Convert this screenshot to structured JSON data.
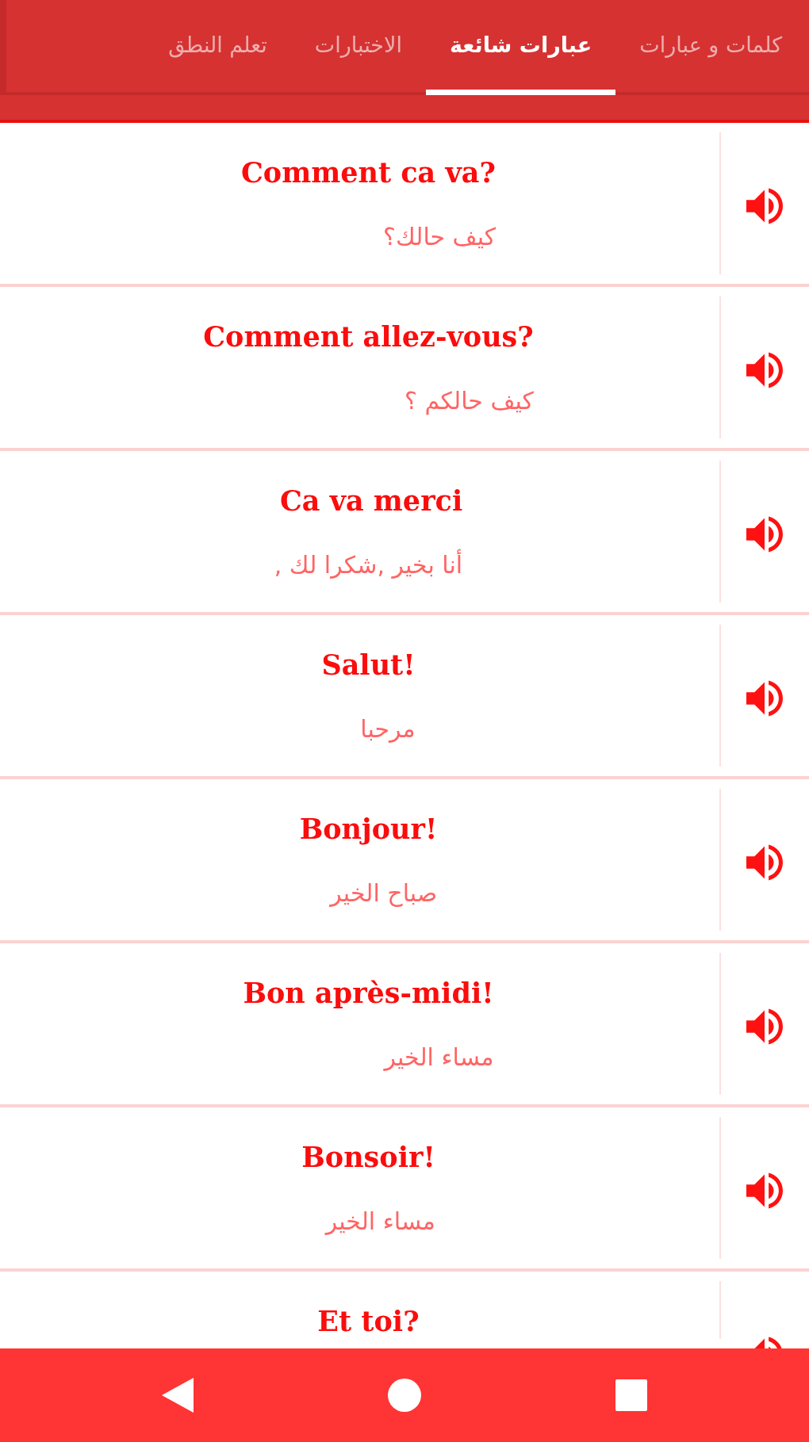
{
  "tabs": [
    {
      "label": "كلمات و عبارات",
      "selected": false
    },
    {
      "label": "عبارات شائعة",
      "selected": true
    },
    {
      "label": "الاختبارات",
      "selected": false
    },
    {
      "label": "تعلم النطق",
      "selected": false
    }
  ],
  "phrases": [
    {
      "french": "Comment ca va?",
      "arabic": "كيف حالك؟"
    },
    {
      "french": "Comment allez-vous?",
      "arabic": "كيف حالكم ؟"
    },
    {
      "french": "Ca va merci",
      "arabic": "أنا بخير ,شكرا لك ,"
    },
    {
      "french": "Salut!",
      "arabic": "مرحبا"
    },
    {
      "french": "Bonjour!",
      "arabic": "صباح الخير"
    },
    {
      "french": "Bon après-midi!",
      "arabic": "مساء الخير"
    },
    {
      "french": "Bonsoir!",
      "arabic": "مساء الخير"
    },
    {
      "french": "Et toi?"
    }
  ]
}
